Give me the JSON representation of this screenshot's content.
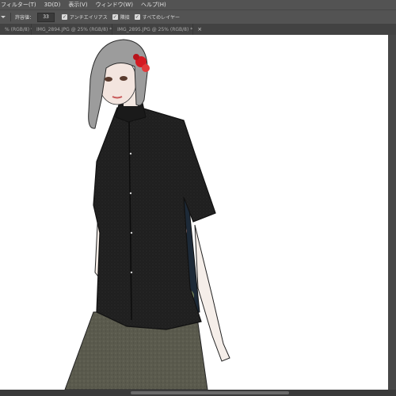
{
  "menu": [
    "フィルター(T)",
    "3D(D)",
    "表示(V)",
    "ウィンドウ(W)",
    "ヘルプ(H)"
  ],
  "options": {
    "tolerance_label": "許容値：",
    "tolerance_value": "33",
    "antialias_label": "アンチエイリアス",
    "contiguous_label": "隣接",
    "all_layers_label": "すべてのレイヤー"
  },
  "tabs": [
    {
      "label": "% (RGB/8) *",
      "close": "×"
    },
    {
      "label": "IMG_2894.JPG @ 25% (RGB/8) *",
      "close": "×"
    },
    {
      "label": "IMG_2895.JPG @ 25% (RGB/8) *",
      "close": "×"
    }
  ],
  "icons": [
    "checkbox-checked-icon",
    "tab-close-icon",
    "dropdown-caret-icon"
  ],
  "colors": {
    "ui_panel": "#535353",
    "tab_bar": "#424242",
    "canvas": "#ffffff",
    "hair_flower": "#d41a22"
  }
}
